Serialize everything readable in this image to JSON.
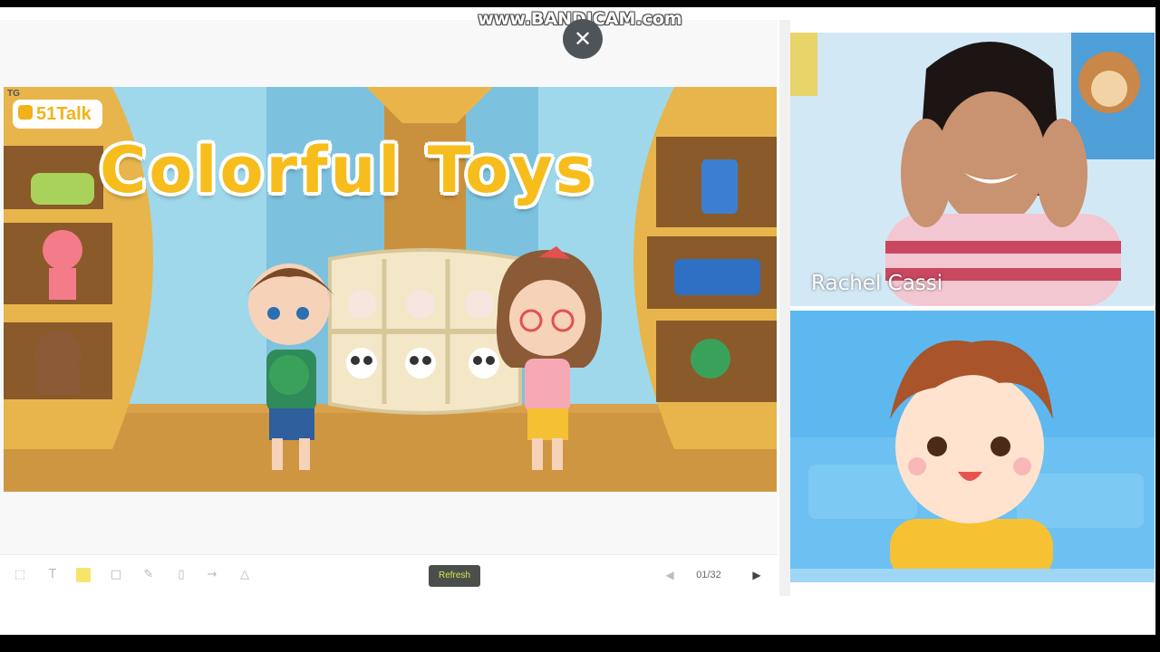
{
  "watermark": "www.BANDICAM.com",
  "slide": {
    "title": "Colorful Toys",
    "logo_badge": "TG",
    "logo_text": "51Talk"
  },
  "toolbar": {
    "refresh_label": "Refresh",
    "page_indicator": "01/32",
    "icons": [
      "crop-icon",
      "text-icon",
      "highlighter-icon",
      "eraser-icon",
      "pen-icon",
      "trash-icon",
      "arrow-icon",
      "shape-icon"
    ]
  },
  "video": {
    "teacher_name": "Rachel Cassi"
  },
  "colors": {
    "title": "#f6bd1c",
    "refresh_text": "#d7e34a",
    "student_bg": "#5db8ef"
  }
}
